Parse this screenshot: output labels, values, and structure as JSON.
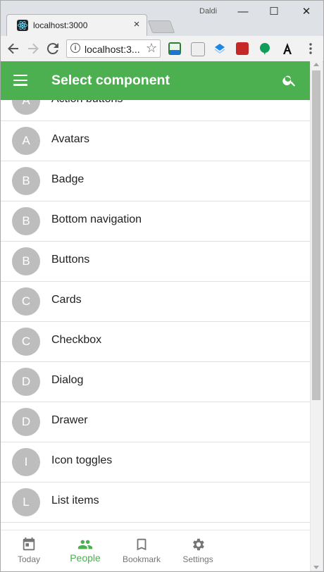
{
  "browser": {
    "tab_title": "localhost:3000",
    "profile_name": "Daldi",
    "address": "localhost:3...",
    "close_symbol": "×",
    "min_symbol": "—",
    "max_symbol": "☐",
    "win_close_symbol": "✕"
  },
  "appbar": {
    "title": "Select component",
    "color": "#4caf50"
  },
  "list": {
    "items": [
      {
        "letter": "A",
        "label": "Action buttons"
      },
      {
        "letter": "A",
        "label": "Avatars"
      },
      {
        "letter": "B",
        "label": "Badge"
      },
      {
        "letter": "B",
        "label": "Bottom navigation"
      },
      {
        "letter": "B",
        "label": "Buttons"
      },
      {
        "letter": "C",
        "label": "Cards"
      },
      {
        "letter": "C",
        "label": "Checkbox"
      },
      {
        "letter": "D",
        "label": "Dialog"
      },
      {
        "letter": "D",
        "label": "Drawer"
      },
      {
        "letter": "I",
        "label": "Icon toggles"
      },
      {
        "letter": "L",
        "label": "List items"
      }
    ]
  },
  "bottom_nav": {
    "items": [
      {
        "label": "Today",
        "icon": "calendar-icon",
        "active": false
      },
      {
        "label": "People",
        "icon": "people-icon",
        "active": true
      },
      {
        "label": "Bookmark",
        "icon": "bookmark-icon",
        "active": false
      },
      {
        "label": "Settings",
        "icon": "gear-icon",
        "active": false
      }
    ],
    "active_color": "#4caf50"
  }
}
